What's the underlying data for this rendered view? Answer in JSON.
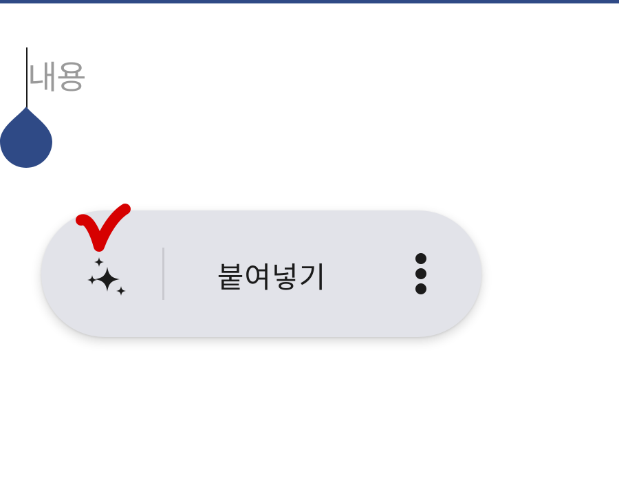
{
  "colors": {
    "accent": "#2f4a86",
    "toolbar_bg": "#e2e3e9",
    "annotation": "#d60000",
    "placeholder": "#9a9a9a",
    "text": "#1b1b1b"
  },
  "editor": {
    "placeholder": "내용"
  },
  "toolbar": {
    "ai_icon": "sparkles-icon",
    "paste_label": "붙여넣기",
    "more_icon": "more-vertical-icon"
  },
  "annotation": {
    "icon": "red-checkmark"
  }
}
